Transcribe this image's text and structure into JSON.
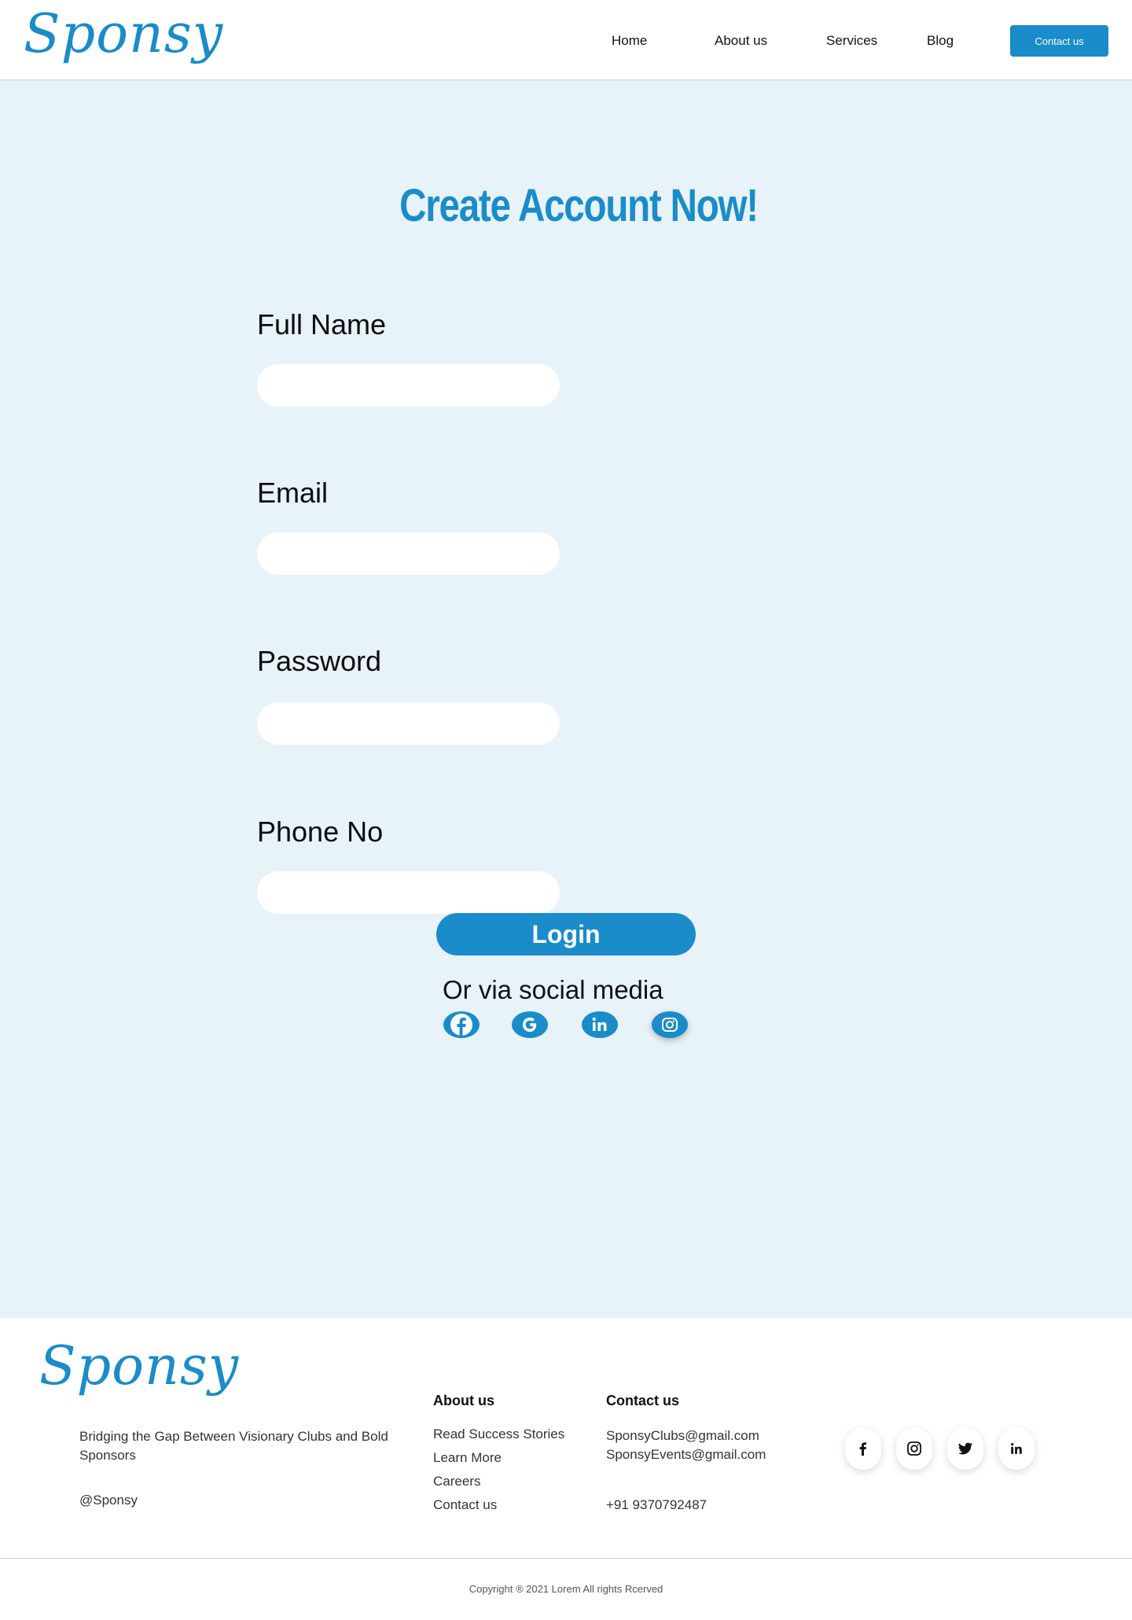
{
  "brand": {
    "name": "Sponsy",
    "accent": "#1a8cca",
    "background": "#e7f2f9"
  },
  "nav": {
    "items": [
      "Home",
      "About us",
      "Services",
      "Blog"
    ],
    "contact_label": "Contact us"
  },
  "form": {
    "title": "Create Account Now!",
    "fields": [
      {
        "label": "Full Name",
        "value": "",
        "placeholder": ""
      },
      {
        "label": "Email",
        "value": "",
        "placeholder": ""
      },
      {
        "label": "Password",
        "value": "",
        "placeholder": ""
      },
      {
        "label": "Phone No",
        "value": "",
        "placeholder": ""
      }
    ],
    "submit_label": "Login",
    "social_text": "Or  via social media",
    "social_icons": [
      "facebook-icon",
      "google-icon",
      "linkedin-icon",
      "instagram-icon"
    ]
  },
  "footer": {
    "tagline": "Bridging the Gap Between Visionary Clubs and Bold Sponsors",
    "handle": "@Sponsy",
    "about": {
      "heading": "About us",
      "links": [
        "Read Success Stories",
        "Learn More",
        "Careers",
        "Contact us"
      ]
    },
    "contact": {
      "heading": "Contact us",
      "emails": [
        "SponsyClubs@gmail.com",
        "SponsyEvents@gmail.com"
      ],
      "phone": "+91 9370792487"
    },
    "social_icons": [
      "facebook-icon",
      "instagram-icon",
      "twitter-icon",
      "linkedin-icon"
    ],
    "copyright": "Copyright ® 2021 Lorem All rights Rcerved"
  }
}
